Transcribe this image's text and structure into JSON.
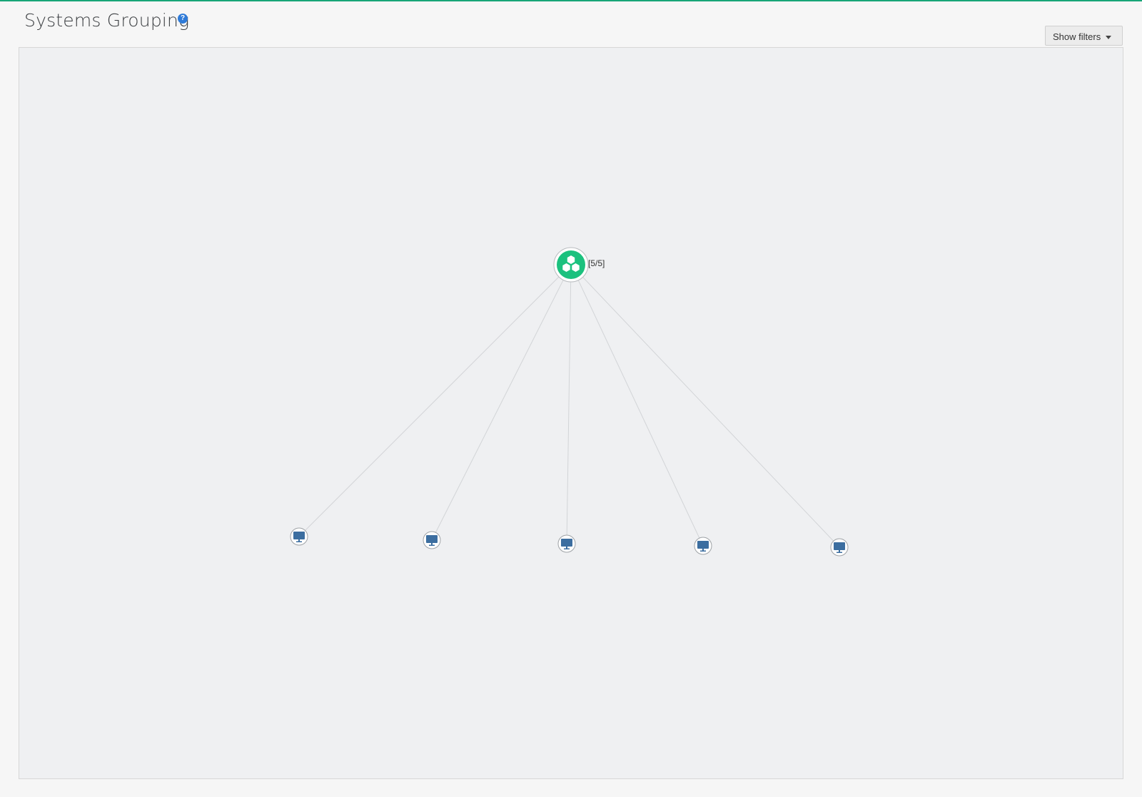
{
  "header": {
    "title": "Systems Grouping",
    "help_glyph": "?"
  },
  "toolbar": {
    "filters_label": "Show filters",
    "filters_icon": "caret-down-icon"
  },
  "graph": {
    "root": {
      "icon": "cluster-group-icon",
      "label": "[5/5]",
      "color": "#1bc17e"
    },
    "systems": [
      {
        "icon": "desktop-monitor-icon",
        "color": "#3c6ea0"
      },
      {
        "icon": "desktop-monitor-icon",
        "color": "#3c6ea0"
      },
      {
        "icon": "desktop-monitor-icon",
        "color": "#3c6ea0"
      },
      {
        "icon": "desktop-monitor-icon",
        "color": "#3c6ea0"
      },
      {
        "icon": "desktop-monitor-icon",
        "color": "#3c6ea0"
      }
    ]
  },
  "colors": {
    "accent": "#17a577",
    "help": "#2f7bd8",
    "edge": "#d2d4d7"
  }
}
